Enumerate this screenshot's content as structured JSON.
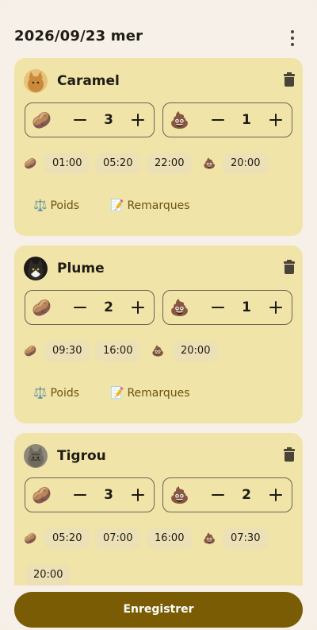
{
  "header": {
    "date": "2026/09/23 mer"
  },
  "icons": {
    "food": "🥔",
    "poop": "💩",
    "scale": "⚖️",
    "memo": "📝"
  },
  "cats": [
    {
      "name": "Caramel",
      "avatar_color": "#d9a55a",
      "food_count": "3",
      "poop_count": "1",
      "food_times": [
        "01:00",
        "05:20",
        "22:00"
      ],
      "poop_times": [
        "20:00"
      ]
    },
    {
      "name": "Plume",
      "avatar_color": "#2b2622",
      "food_count": "2",
      "poop_count": "1",
      "food_times": [
        "09:30",
        "16:00"
      ],
      "poop_times": [
        "20:00"
      ]
    },
    {
      "name": "Tigrou",
      "avatar_color": "#7b7566",
      "food_count": "3",
      "poop_count": "2",
      "food_times": [
        "05:20",
        "07:00",
        "16:00"
      ],
      "poop_times": [
        "07:30",
        "20:00"
      ]
    }
  ],
  "actions": {
    "weight_label": "Poids",
    "notes_label": "Remarques"
  },
  "footer": {
    "save_label": "Enregistrer"
  }
}
